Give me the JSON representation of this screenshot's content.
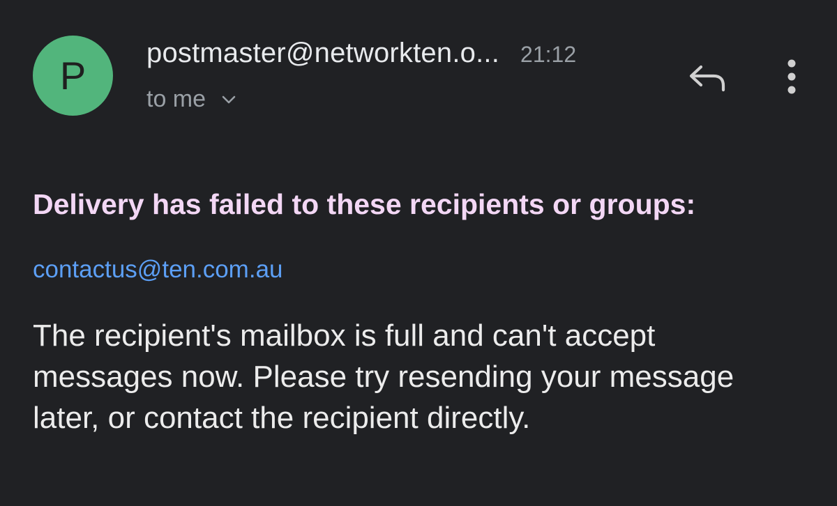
{
  "header": {
    "avatar_letter": "P",
    "sender": "postmaster@networkten.o...",
    "time": "21:12",
    "recipient_label": "to me",
    "icons": {
      "avatar": "sender-avatar",
      "expand": "chevron-down-icon",
      "reply": "reply-icon",
      "more": "more-vert-icon"
    }
  },
  "body": {
    "heading": "Delivery has failed to these recipients or groups:",
    "recipient_email": "contactus@ten.com.au",
    "message": "The recipient's mailbox is full and can't accept messages now. Please try resending your message later, or contact the recipient directly."
  },
  "colors": {
    "background": "#202124",
    "avatar": "#52b57c",
    "heading": "#f3d7f5",
    "link": "#5c9ff5",
    "secondary_text": "#9aa0a6"
  }
}
